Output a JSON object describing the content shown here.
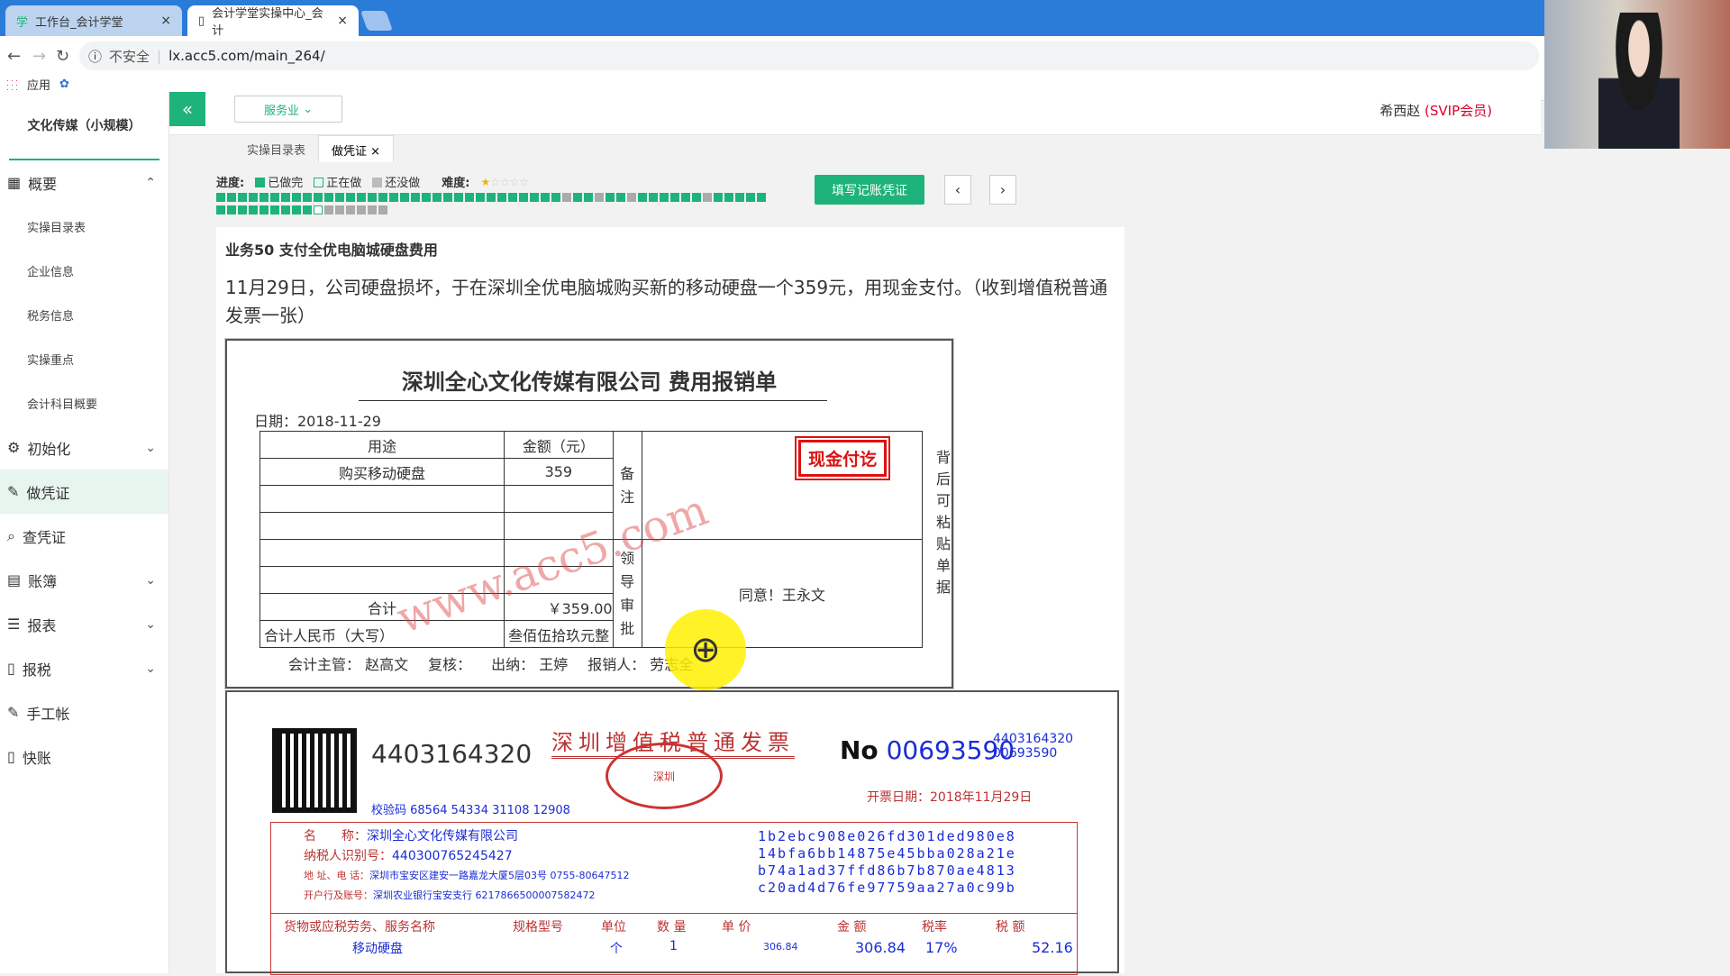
{
  "browser": {
    "tabs": [
      {
        "label": "工作台_会计学堂"
      },
      {
        "label": "会计学堂实操中心_会计"
      }
    ],
    "security_label": "不安全",
    "url": "lx.acc5.com/main_264/",
    "bookmarks_label": "应用"
  },
  "sidebar": {
    "company": "文化传媒（小规模）",
    "items": [
      {
        "label": "概要",
        "icon": "grid-icon"
      },
      {
        "label": "初始化",
        "icon": "gear-icon"
      },
      {
        "label": "做凭证",
        "icon": "pen-icon"
      },
      {
        "label": "查凭证",
        "icon": "search-icon"
      },
      {
        "label": "账簿",
        "icon": "book-icon"
      },
      {
        "label": "报表",
        "icon": "list-icon"
      },
      {
        "label": "报税",
        "icon": "doc-icon"
      },
      {
        "label": "手工帐",
        "icon": "pen-icon"
      },
      {
        "label": "快账",
        "icon": "doc-icon"
      }
    ],
    "subitems": [
      "实操目录表",
      "企业信息",
      "税务信息",
      "实操重点",
      "会计科目概要"
    ]
  },
  "topbar": {
    "industry": "服务业",
    "user_name": "希西赵",
    "user_vip": "(SVIP会员)"
  },
  "subtabs": [
    "实操目录表",
    "做凭证"
  ],
  "progress": {
    "label": "进度:",
    "done": "已做完",
    "doing": "正在做",
    "todo": "还没做",
    "difficulty_label": "难度:",
    "difficulty_stars": 1,
    "difficulty_max": 5
  },
  "actions": {
    "fill_voucher": "填写记账凭证"
  },
  "task": {
    "title": "业务50 支付全优电脑城硬盘费用",
    "description": "11月29日，公司硬盘损坏，于在深圳全优电脑城购买新的移动硬盘一个359元，用现金支付。（收到增值税普通发票一张）"
  },
  "reimbursement": {
    "title": "深圳全心文化传媒有限公司 费用报销单",
    "date": "日期：2018-11-29",
    "col_purpose": "用途",
    "col_amount": "金额（元）",
    "item": "购买移动硬盘",
    "amount": "359",
    "remark_label": "备注",
    "stamp": "现金付讫",
    "approval_label": "领导审批",
    "approval_text": "同意！王永文",
    "total_label": "合计",
    "total_value": "￥359.00",
    "rmb_label": "合计人民币（大写）",
    "rmb_value": "叁佰伍拾玖元整",
    "side_note": "背后可粘贴单据",
    "supervisor": "会计主管：  赵高文",
    "reviewer": "复核：",
    "cashier": "出纳：  王婷",
    "applicant": "报销人：  劳志全",
    "watermark": "www.acc5.com"
  },
  "invoice": {
    "code": "4403164320",
    "title": "深圳增值税普通发票",
    "seal_text": "深圳",
    "no_label": "No",
    "number": "00693590",
    "code_small": "4403164320",
    "number_small": "00693590",
    "date": "开票日期：2018年11月29日",
    "check_code": "校验码 68564 54334 31108 12908",
    "buyer_name_label": "名　　称：",
    "buyer_name": "深圳全心文化传媒有限公司",
    "buyer_tax_label": "纳税人识别号：",
    "buyer_tax": "440300765245427",
    "buyer_addr_label": "地 址、电 话：",
    "buyer_addr": "深圳市宝安区建安一路嘉龙大厦5层03号 0755-80647512",
    "buyer_bank_label": "开户行及账号：",
    "buyer_bank": "深圳农业银行宝安支行 6217866500007582472",
    "cipher": [
      "1b2ebc908e026fd301ded980e8",
      "14bfa6bb14875e45bba028a21e",
      "b74a1ad37ffd86b7b870ae4813",
      "c20ad4d76fe97759aa27a0c99b"
    ],
    "col_goods": "货物或应税劳务、服务名称",
    "col_spec": "规格型号",
    "col_unit": "单位",
    "col_qty": "数 量",
    "col_price": "单 价",
    "col_amount": "金 额",
    "col_rate": "税率",
    "col_tax": "税 额",
    "goods": "移动硬盘",
    "unit": "个",
    "qty": "1",
    "price": "306.84",
    "amount": "306.84",
    "rate": "17%",
    "tax": "52.16"
  }
}
